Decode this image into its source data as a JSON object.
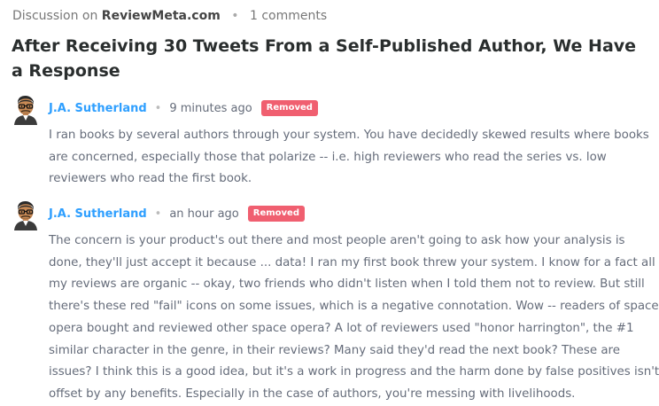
{
  "header": {
    "prefix": "Discussion on",
    "site": "ReviewMeta.com",
    "comments": "1 comments"
  },
  "title": "After Receiving 30 Tweets From a Self-Published Author, We Have a Response",
  "comments": [
    {
      "author": "J.A. Sutherland",
      "time": "9 minutes ago",
      "badge": "Removed",
      "text": "I ran books by several authors through your system. You have decidedly skewed results where books\nare concerned, especially those that polarize -- i.e. high reviewers who read the series vs. low\nreviewers who read the first book."
    },
    {
      "author": "J.A. Sutherland",
      "time": "an hour ago",
      "badge": "Removed",
      "text": "The concern is your product's out there and most people aren't going to ask how your analysis is\ndone, they'll just accept it because ... data! I ran my first book threw your system. I know for a fact all\nmy reviews are organic -- okay, two friends who didn't listen when I told them not to review. But still\nthere's these red \"fail\" icons on some issues, which is a negative connotation. Wow -- readers of space\nopera bought and reviewed other space opera? A lot of reviewers used \"honor harrington\", the #1\nsimilar character in the genre, in their reviews? Many said they'd read the next book? These are\nissues? I think this is a good idea, but it's a work in progress and the harm done by false positives isn't\noffset by any benefits. Especially in the case of authors, you're messing with livelihoods."
    }
  ],
  "colors": {
    "author": "#2e9fff",
    "badge": "#f05f70",
    "body_text": "#656c7a",
    "title": "#2a2e2e"
  }
}
